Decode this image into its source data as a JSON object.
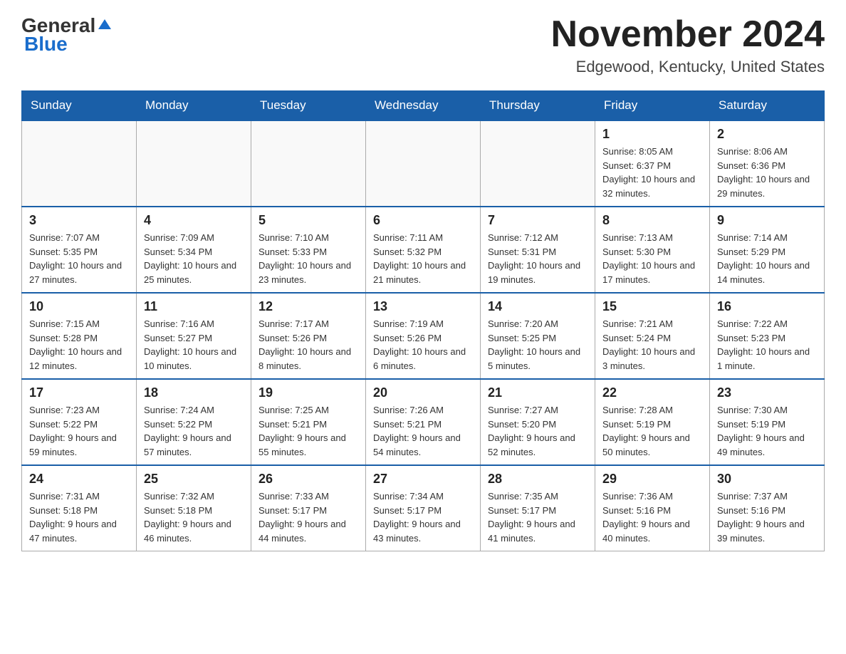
{
  "header": {
    "logo_general": "General",
    "logo_blue": "Blue",
    "title": "November 2024",
    "location": "Edgewood, Kentucky, United States"
  },
  "weekdays": [
    "Sunday",
    "Monday",
    "Tuesday",
    "Wednesday",
    "Thursday",
    "Friday",
    "Saturday"
  ],
  "weeks": [
    [
      {
        "day": "",
        "info": ""
      },
      {
        "day": "",
        "info": ""
      },
      {
        "day": "",
        "info": ""
      },
      {
        "day": "",
        "info": ""
      },
      {
        "day": "",
        "info": ""
      },
      {
        "day": "1",
        "info": "Sunrise: 8:05 AM\nSunset: 6:37 PM\nDaylight: 10 hours and 32 minutes."
      },
      {
        "day": "2",
        "info": "Sunrise: 8:06 AM\nSunset: 6:36 PM\nDaylight: 10 hours and 29 minutes."
      }
    ],
    [
      {
        "day": "3",
        "info": "Sunrise: 7:07 AM\nSunset: 5:35 PM\nDaylight: 10 hours and 27 minutes."
      },
      {
        "day": "4",
        "info": "Sunrise: 7:09 AM\nSunset: 5:34 PM\nDaylight: 10 hours and 25 minutes."
      },
      {
        "day": "5",
        "info": "Sunrise: 7:10 AM\nSunset: 5:33 PM\nDaylight: 10 hours and 23 minutes."
      },
      {
        "day": "6",
        "info": "Sunrise: 7:11 AM\nSunset: 5:32 PM\nDaylight: 10 hours and 21 minutes."
      },
      {
        "day": "7",
        "info": "Sunrise: 7:12 AM\nSunset: 5:31 PM\nDaylight: 10 hours and 19 minutes."
      },
      {
        "day": "8",
        "info": "Sunrise: 7:13 AM\nSunset: 5:30 PM\nDaylight: 10 hours and 17 minutes."
      },
      {
        "day": "9",
        "info": "Sunrise: 7:14 AM\nSunset: 5:29 PM\nDaylight: 10 hours and 14 minutes."
      }
    ],
    [
      {
        "day": "10",
        "info": "Sunrise: 7:15 AM\nSunset: 5:28 PM\nDaylight: 10 hours and 12 minutes."
      },
      {
        "day": "11",
        "info": "Sunrise: 7:16 AM\nSunset: 5:27 PM\nDaylight: 10 hours and 10 minutes."
      },
      {
        "day": "12",
        "info": "Sunrise: 7:17 AM\nSunset: 5:26 PM\nDaylight: 10 hours and 8 minutes."
      },
      {
        "day": "13",
        "info": "Sunrise: 7:19 AM\nSunset: 5:26 PM\nDaylight: 10 hours and 6 minutes."
      },
      {
        "day": "14",
        "info": "Sunrise: 7:20 AM\nSunset: 5:25 PM\nDaylight: 10 hours and 5 minutes."
      },
      {
        "day": "15",
        "info": "Sunrise: 7:21 AM\nSunset: 5:24 PM\nDaylight: 10 hours and 3 minutes."
      },
      {
        "day": "16",
        "info": "Sunrise: 7:22 AM\nSunset: 5:23 PM\nDaylight: 10 hours and 1 minute."
      }
    ],
    [
      {
        "day": "17",
        "info": "Sunrise: 7:23 AM\nSunset: 5:22 PM\nDaylight: 9 hours and 59 minutes."
      },
      {
        "day": "18",
        "info": "Sunrise: 7:24 AM\nSunset: 5:22 PM\nDaylight: 9 hours and 57 minutes."
      },
      {
        "day": "19",
        "info": "Sunrise: 7:25 AM\nSunset: 5:21 PM\nDaylight: 9 hours and 55 minutes."
      },
      {
        "day": "20",
        "info": "Sunrise: 7:26 AM\nSunset: 5:21 PM\nDaylight: 9 hours and 54 minutes."
      },
      {
        "day": "21",
        "info": "Sunrise: 7:27 AM\nSunset: 5:20 PM\nDaylight: 9 hours and 52 minutes."
      },
      {
        "day": "22",
        "info": "Sunrise: 7:28 AM\nSunset: 5:19 PM\nDaylight: 9 hours and 50 minutes."
      },
      {
        "day": "23",
        "info": "Sunrise: 7:30 AM\nSunset: 5:19 PM\nDaylight: 9 hours and 49 minutes."
      }
    ],
    [
      {
        "day": "24",
        "info": "Sunrise: 7:31 AM\nSunset: 5:18 PM\nDaylight: 9 hours and 47 minutes."
      },
      {
        "day": "25",
        "info": "Sunrise: 7:32 AM\nSunset: 5:18 PM\nDaylight: 9 hours and 46 minutes."
      },
      {
        "day": "26",
        "info": "Sunrise: 7:33 AM\nSunset: 5:17 PM\nDaylight: 9 hours and 44 minutes."
      },
      {
        "day": "27",
        "info": "Sunrise: 7:34 AM\nSunset: 5:17 PM\nDaylight: 9 hours and 43 minutes."
      },
      {
        "day": "28",
        "info": "Sunrise: 7:35 AM\nSunset: 5:17 PM\nDaylight: 9 hours and 41 minutes."
      },
      {
        "day": "29",
        "info": "Sunrise: 7:36 AM\nSunset: 5:16 PM\nDaylight: 9 hours and 40 minutes."
      },
      {
        "day": "30",
        "info": "Sunrise: 7:37 AM\nSunset: 5:16 PM\nDaylight: 9 hours and 39 minutes."
      }
    ]
  ]
}
